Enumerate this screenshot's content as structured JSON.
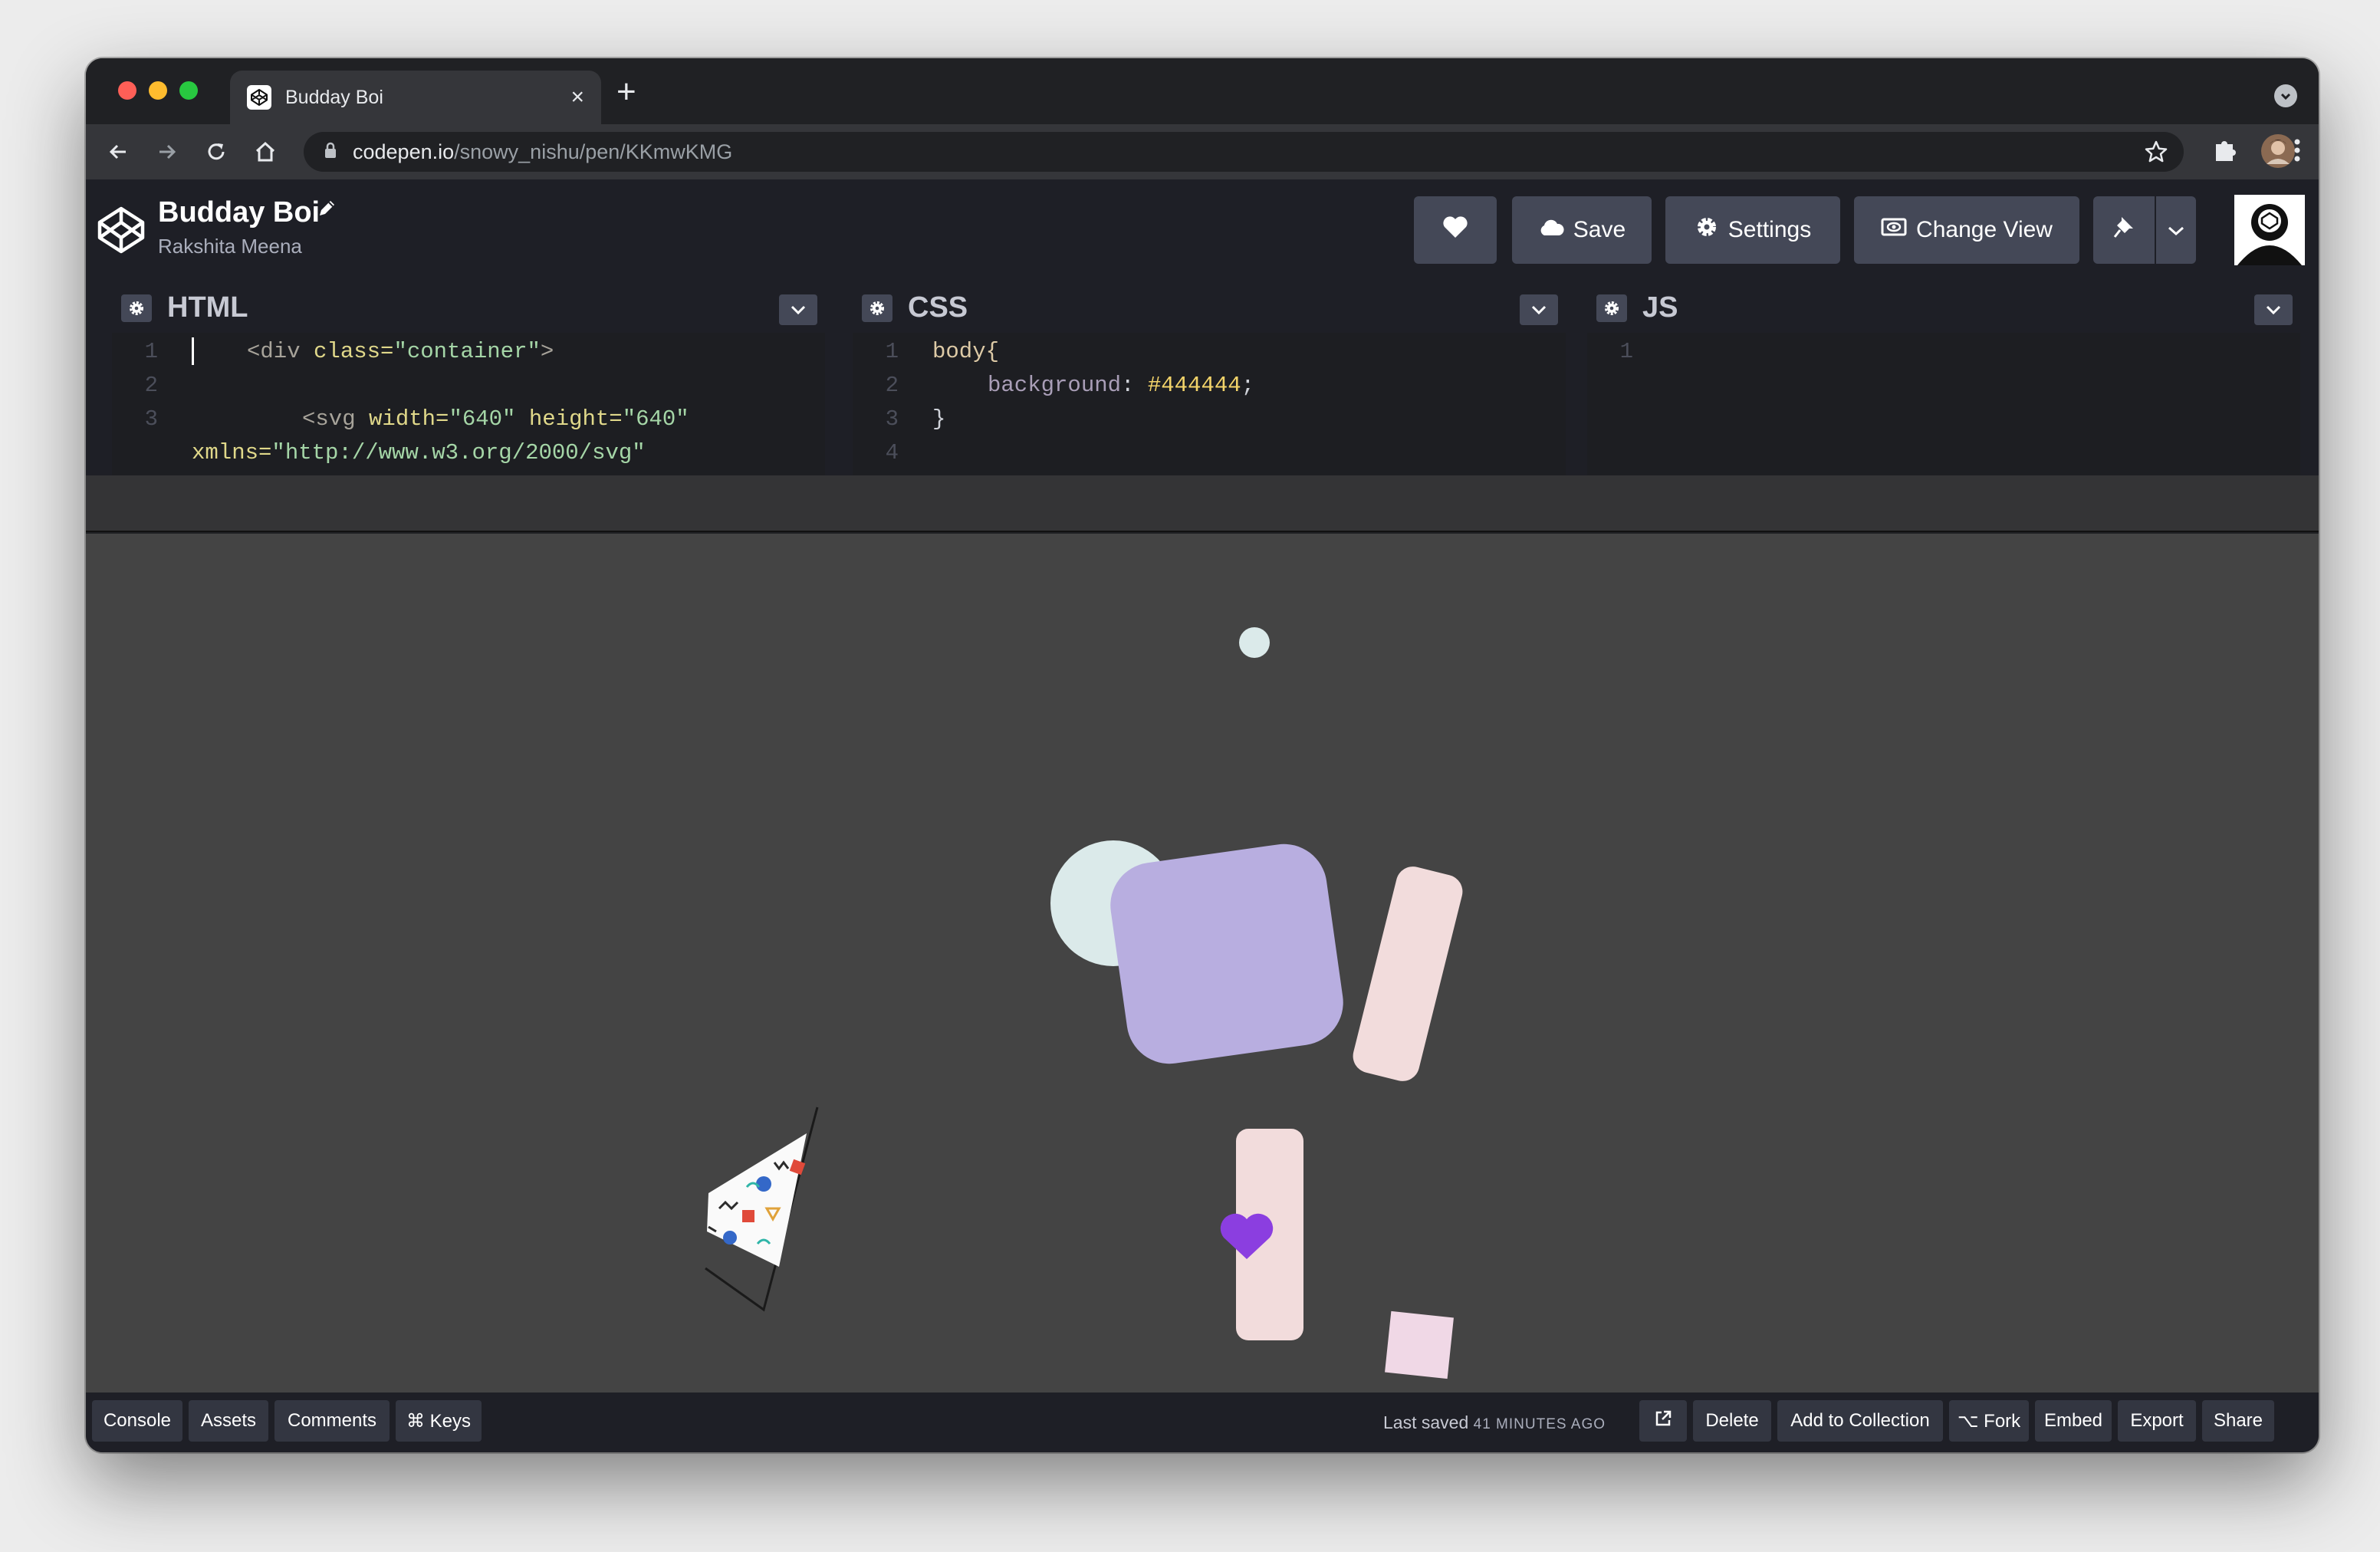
{
  "browser": {
    "tab_title": "Budday Boi",
    "new_tab_symbol": "+",
    "close_symbol": "×",
    "url_host": "codepen.io",
    "url_path": "/snowy_nishu/pen/KKmwKMG"
  },
  "header": {
    "title": "Budday Boi",
    "author": "Rakshita Meena",
    "save_label": "Save",
    "settings_label": "Settings",
    "change_view_label": "Change View"
  },
  "panes": {
    "html": {
      "title": "HTML",
      "lines": [
        "1",
        "2",
        "3"
      ],
      "code_line1_tag": "<div ",
      "code_line1_attr": "class=",
      "code_line1_str": "\"container\"",
      "code_line1_end": ">",
      "code_line3_tag": "<svg ",
      "code_line3_attr1": "width=",
      "code_line3_str1": "\"640\"",
      "code_line3_attr2": " height=",
      "code_line3_str2": "\"640\"",
      "code_line4_attr": "xmlns=",
      "code_line4_str": "\"http://www.w3.org/2000/svg\""
    },
    "css": {
      "title": "CSS",
      "lines": [
        "1",
        "2",
        "3",
        "4"
      ],
      "selector": "body{",
      "prop": "background",
      "colon": ": ",
      "value": "#444444",
      "semi": ";",
      "close": "}"
    },
    "js": {
      "title": "JS",
      "lines": [
        "1"
      ]
    }
  },
  "footer": {
    "console": "Console",
    "assets": "Assets",
    "comments": "Comments",
    "keys": "⌘ Keys",
    "last_saved_prefix": "Last saved",
    "last_saved_time": "41 MINUTES AGO",
    "delete": "Delete",
    "add_to_collection": "Add to Collection",
    "fork": "⌥ Fork",
    "embed": "Embed",
    "export": "Export",
    "share": "Share"
  },
  "icons": {
    "back": "arrow-left-icon",
    "forward": "arrow-right-icon",
    "reload": "reload-icon",
    "home": "home-icon",
    "lock": "lock-icon",
    "star": "star-icon",
    "extensions": "puzzle-icon",
    "menu": "kebab-icon",
    "heart": "heart-icon",
    "cloud": "cloud-icon",
    "gear": "gear-icon",
    "view": "eye-icon",
    "pin": "pin-icon",
    "chevron": "chevron-down-icon"
  },
  "colors": {
    "preview_background": "#444444",
    "codepen_chrome": "#1e1f26",
    "button": "#444857",
    "lavender": "#b8aee0",
    "pink": "#f2dcdc",
    "mint": "#dbeaea",
    "heart": "#8b3ee0"
  }
}
